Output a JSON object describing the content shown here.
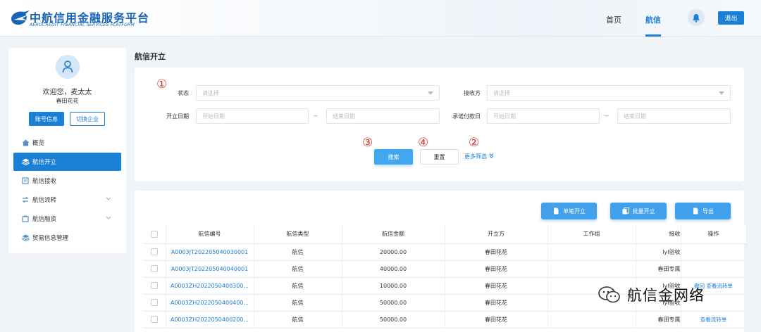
{
  "header": {
    "logo_cn": "中航信用金融服务平台",
    "logo_en": "AEROCREDIT FINANCIAL SERVICES PLATFORM",
    "nav_home": "首页",
    "nav_hangxin": "航信",
    "logout": "退出",
    "accent_color": "#1a7fd6"
  },
  "sidebar": {
    "welcome": "欢迎您，麦太太",
    "company": "春田花花",
    "btn_account": "账号信息",
    "btn_switch": "切换企业",
    "items": [
      {
        "label": "概览",
        "icon": "home-icon"
      },
      {
        "label": "航信开立",
        "icon": "layers-icon"
      },
      {
        "label": "航信接收",
        "icon": "receive-icon"
      },
      {
        "label": "航信流转",
        "icon": "transfer-icon"
      },
      {
        "label": "航信融资",
        "icon": "finance-icon"
      },
      {
        "label": "贸易信息管理",
        "icon": "trade-icon"
      }
    ]
  },
  "main": {
    "page_title": "航信开立",
    "annotations": [
      "①",
      "②",
      "③",
      "④"
    ],
    "filters": {
      "status_label": "状态",
      "status_placeholder": "请选择",
      "receiver_label": "接收方",
      "receiver_placeholder": "请选择",
      "open_date_label": "开立日期",
      "start_placeholder": "开始日期",
      "end_placeholder": "结束日期",
      "pay_date_label": "承诺付款日",
      "separator": "--"
    },
    "search_btn": "搜索",
    "reset_btn": "重置",
    "more_filter": "更多筛选",
    "toolbar": {
      "single_open": "单笔开立",
      "batch_open": "批量开立",
      "export": "导出"
    },
    "table": {
      "columns": [
        "航信编号",
        "航信类型",
        "航信金额",
        "开立方",
        "工作组",
        "接收",
        "操作"
      ],
      "rows": [
        {
          "id": "A0003JT202205040030001",
          "type": "航信",
          "amount": "20000.00",
          "issuer": "春田花花",
          "group": "",
          "receiver": "lyl验收",
          "ops": ""
        },
        {
          "id": "A0003JT202205040040001",
          "type": "航信",
          "amount": "40000.00",
          "issuer": "春田花花",
          "group": "",
          "receiver": "春田专属",
          "ops": ""
        },
        {
          "id": "A0003ZH2022050400300...",
          "type": "航信",
          "amount": "10000.00",
          "issuer": "春田花花",
          "group": "",
          "receiver": "lyl验收",
          "ops": "撤回 查看流转单"
        },
        {
          "id": "A0003ZH2022050400400...",
          "type": "航信",
          "amount": "50000.00",
          "issuer": "春田花花",
          "group": "",
          "receiver": "lyl验收",
          "ops": ""
        },
        {
          "id": "A0003ZH2022050400200...",
          "type": "航信",
          "amount": "50000.00",
          "issuer": "春田花花",
          "group": "",
          "receiver": "春田专属",
          "ops": "查看流转单"
        }
      ]
    }
  },
  "watermark": {
    "text": "航信金网络"
  }
}
